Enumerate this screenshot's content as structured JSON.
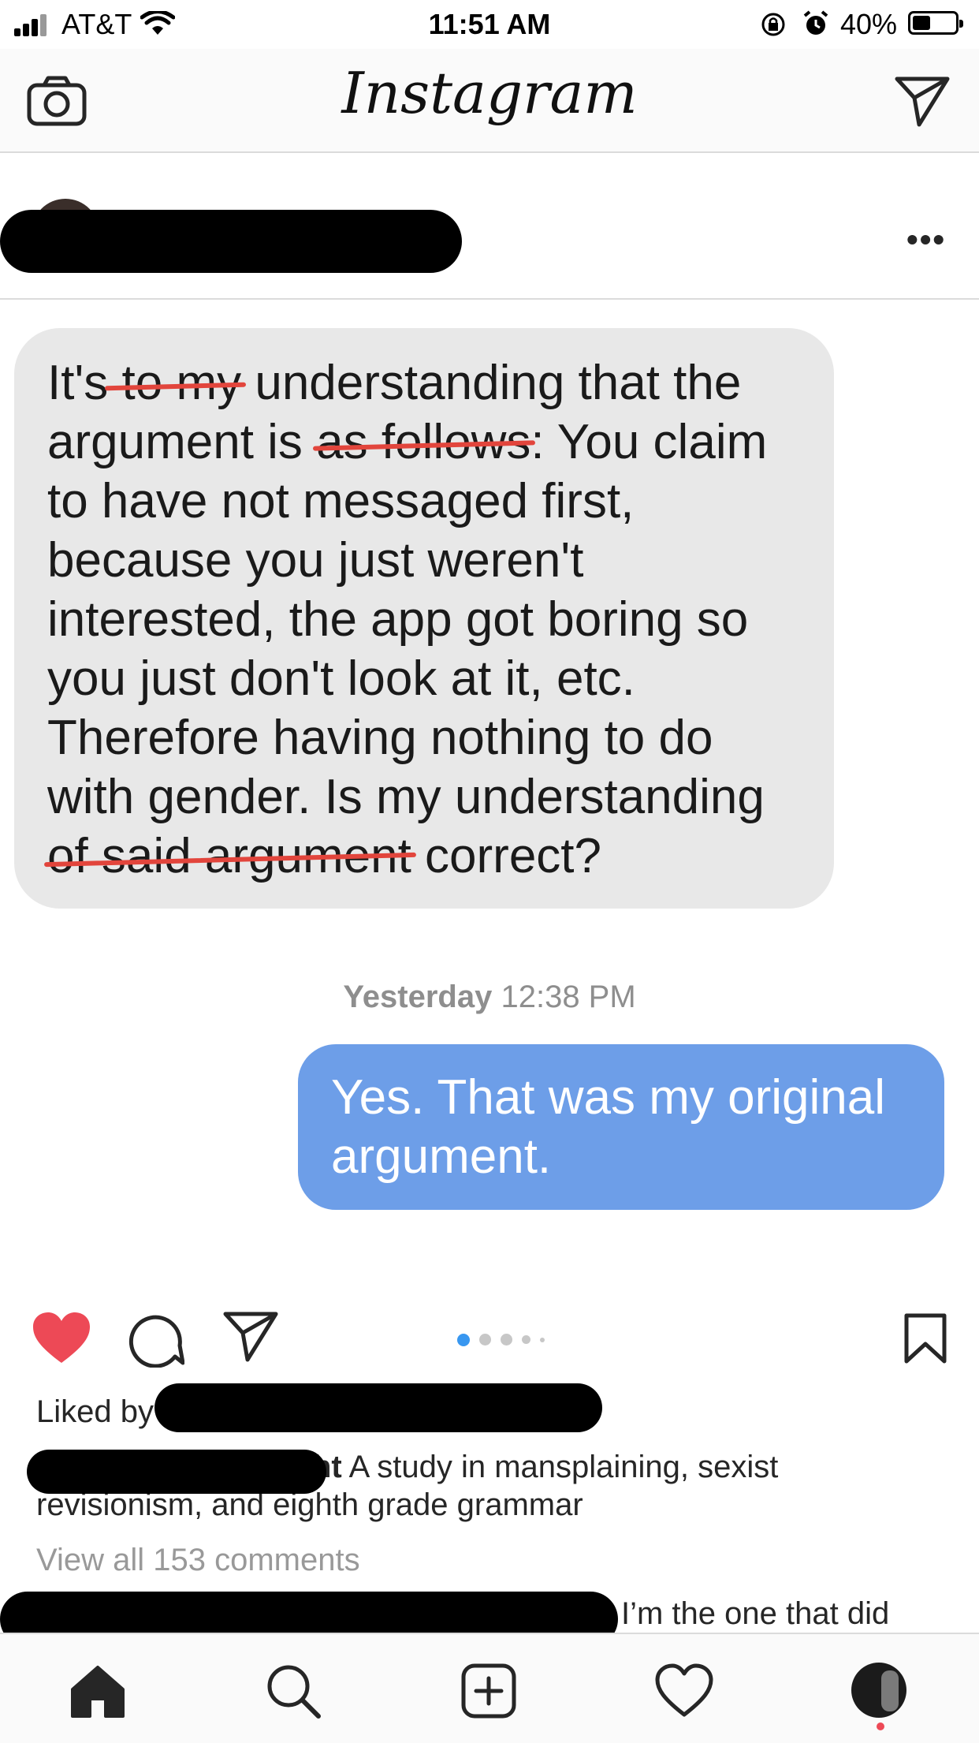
{
  "status_bar": {
    "carrier": "AT&T",
    "time": "11:51 AM",
    "battery_percent": "40%",
    "battery_level": 0.4
  },
  "nav": {
    "title": "Instagram",
    "left_icon": "camera-icon",
    "right_icon": "direct-message-icon"
  },
  "post": {
    "more_icon": "more-options-icon",
    "incoming_message": {
      "parts": [
        {
          "text": "It's",
          "struck": false
        },
        {
          "text": " to my",
          "struck": true
        },
        {
          "text": " understanding that the argument is ",
          "struck": false
        },
        {
          "text": "as follows",
          "struck": true
        },
        {
          "text": ": You claim to have not messaged first, because you just weren't interested, the app got boring so you just don't look at it, etc. Therefore having nothing to do with gender. Is my understanding ",
          "struck": false
        },
        {
          "text": "of said argument",
          "struck": true
        },
        {
          "text": " correct?",
          "struck": false
        }
      ]
    },
    "timestamp_day": "Yesterday",
    "timestamp_time": "12:38 PM",
    "outgoing_message": "Yes. That was my original argument.",
    "carousel": {
      "count": 5,
      "active_index": 0
    },
    "liked_by_prefix": "Liked by",
    "caption_user_visible": "ht",
    "caption_text": "A study in mansplaining, sexist revisionism, and eighth grade grammar",
    "view_comments": "View all 153 comments",
    "comment_text": "I’m the one that did",
    "liked": true,
    "colors": {
      "like": "#ed4956",
      "incoming_bubble": "#e8e8e8",
      "outgoing_bubble": "#6d9ee8",
      "carousel_active": "#3897f0",
      "strike": "#e2453c"
    }
  },
  "tab_bar": {
    "items": [
      {
        "name": "home-icon"
      },
      {
        "name": "search-icon"
      },
      {
        "name": "new-post-icon"
      },
      {
        "name": "activity-heart-icon"
      },
      {
        "name": "profile-avatar"
      }
    ]
  }
}
